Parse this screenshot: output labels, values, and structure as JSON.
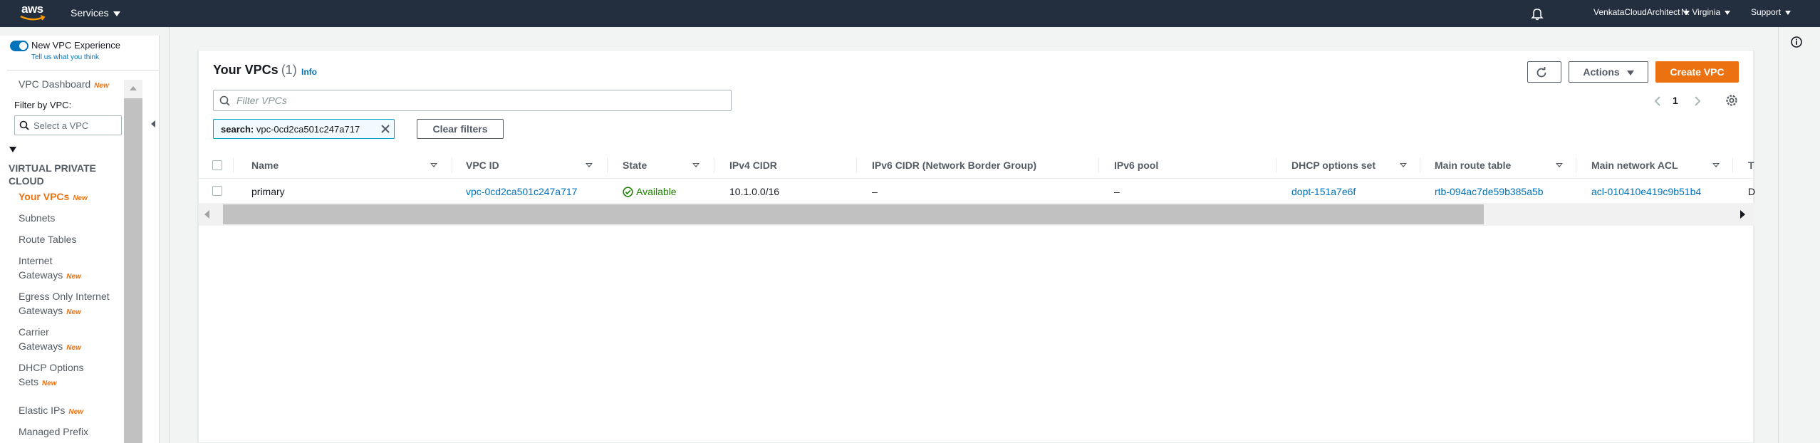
{
  "topnav": {
    "logo_text": "aws",
    "services_label": "Services",
    "account_label": "VenkataCloudArchitect",
    "region_label": "N. Virginia",
    "support_label": "Support"
  },
  "sidebar": {
    "toggle_label": "New VPC Experience",
    "tell_us": "Tell us what you think",
    "dashboard_label": "VPC Dashboard",
    "new_badge": "New",
    "filter_label": "Filter by VPC:",
    "filter_placeholder": "Select a VPC",
    "section_title": "VIRTUAL PRIVATE CLOUD",
    "items": [
      {
        "label": "Your VPCs",
        "badge": "New",
        "active": true
      },
      {
        "label": "Subnets",
        "badge": ""
      },
      {
        "label": "Route Tables",
        "badge": ""
      },
      {
        "label": "Internet",
        "label2": "Gateways",
        "badge": "New"
      },
      {
        "label": "Egress Only Internet",
        "label2": "Gateways",
        "badge": "New"
      },
      {
        "label": "Carrier",
        "label2": "Gateways",
        "badge": "New"
      },
      {
        "label": "DHCP Options",
        "label2": "Sets",
        "badge": "New"
      },
      {
        "label": "Elastic IPs",
        "badge": "New"
      },
      {
        "label": "Managed Prefix",
        "badge": ""
      }
    ]
  },
  "panel": {
    "title": "Your VPCs",
    "count": "(1)",
    "info_label": "Info",
    "actions_label": "Actions",
    "create_label": "Create VPC",
    "filter_placeholder": "Filter VPCs",
    "page_number": "1",
    "token_key": "search:",
    "token_value": "vpc-0cd2ca501c247a717",
    "clear_filters_label": "Clear filters"
  },
  "table": {
    "columns": [
      "Name",
      "VPC ID",
      "State",
      "IPv4 CIDR",
      "IPv6 CIDR (Network Border Group)",
      "IPv6 pool",
      "DHCP options set",
      "Main route table",
      "Main network ACL",
      "T"
    ],
    "rows": [
      {
        "name": "primary",
        "vpc_id": "vpc-0cd2ca501c247a717",
        "state": "Available",
        "ipv4_cidr": "10.1.0.0/16",
        "ipv6_cidr": "–",
        "ipv6_pool": "–",
        "dhcp_options": "dopt-151a7e6f",
        "main_route_table": "rtb-094ac7de59b385a5b",
        "main_network_acl": "acl-010410e419c9b51b4",
        "tenancy": "D"
      }
    ]
  },
  "colors": {
    "nav_bg": "#232f3e",
    "accent": "#ec7211",
    "link": "#0073bb",
    "success": "#1d8102"
  }
}
